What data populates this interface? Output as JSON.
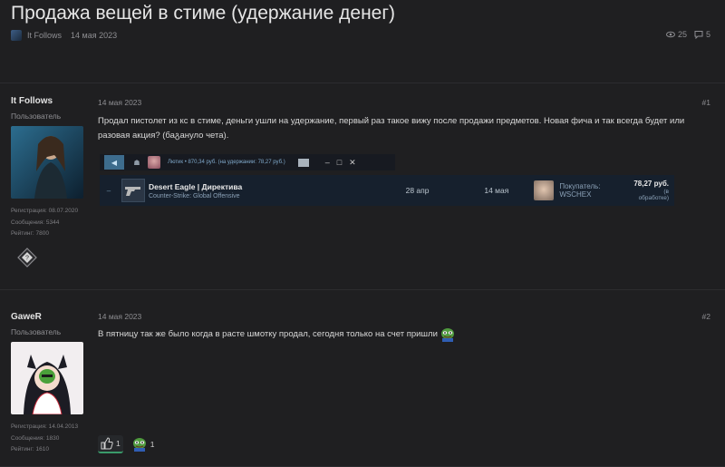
{
  "thread": {
    "title": "Продажа вещей в стиме (удержание денег)",
    "author": "It Follows",
    "date": "14 мая 2023",
    "views": "25",
    "replies": "5"
  },
  "posts": [
    {
      "author": "It Follows",
      "role": "Пользователь",
      "registered": "Регистрация: 08.07.2020",
      "messages": "Сообщения: 5344",
      "rating": "Рейтинг: 7800",
      "date": "14 мая 2023",
      "number": "#1",
      "text": "Продал пистолет из кс в стиме, деньги ушли на удержание, первый раз такое вижу после продажи предметов. Новая фича и так всегда будет или разовая акция? (баგануло чета).",
      "steam": {
        "user_line": "Лютик • 870,34 руб. (на удержании: 78,27 руб.)",
        "item_name": "Desert Eagle | Директива",
        "item_game": "Counter-Strike: Global Offensive",
        "listed_date": "28 апр",
        "sold_date": "14 мая",
        "buyer_label": "Покупатель:",
        "buyer_name": "WSCHEX",
        "price": "78,27 руб.",
        "price_status": "(в обработке)"
      }
    },
    {
      "author": "GaweR",
      "role": "Пользователь",
      "registered": "Регистрация: 14.04.2013",
      "messages": "Сообщения: 1830",
      "rating": "Рейтинг: 1610",
      "date": "14 мая 2023",
      "number": "#2",
      "text": "В пятницу так же было когда в расте шмотку продал, сегодня только на счет пришли",
      "reactions": [
        {
          "icon": "thumbs-up-icon",
          "count": "1"
        },
        {
          "icon": "pepe-icon",
          "count": "1"
        }
      ]
    }
  ]
}
